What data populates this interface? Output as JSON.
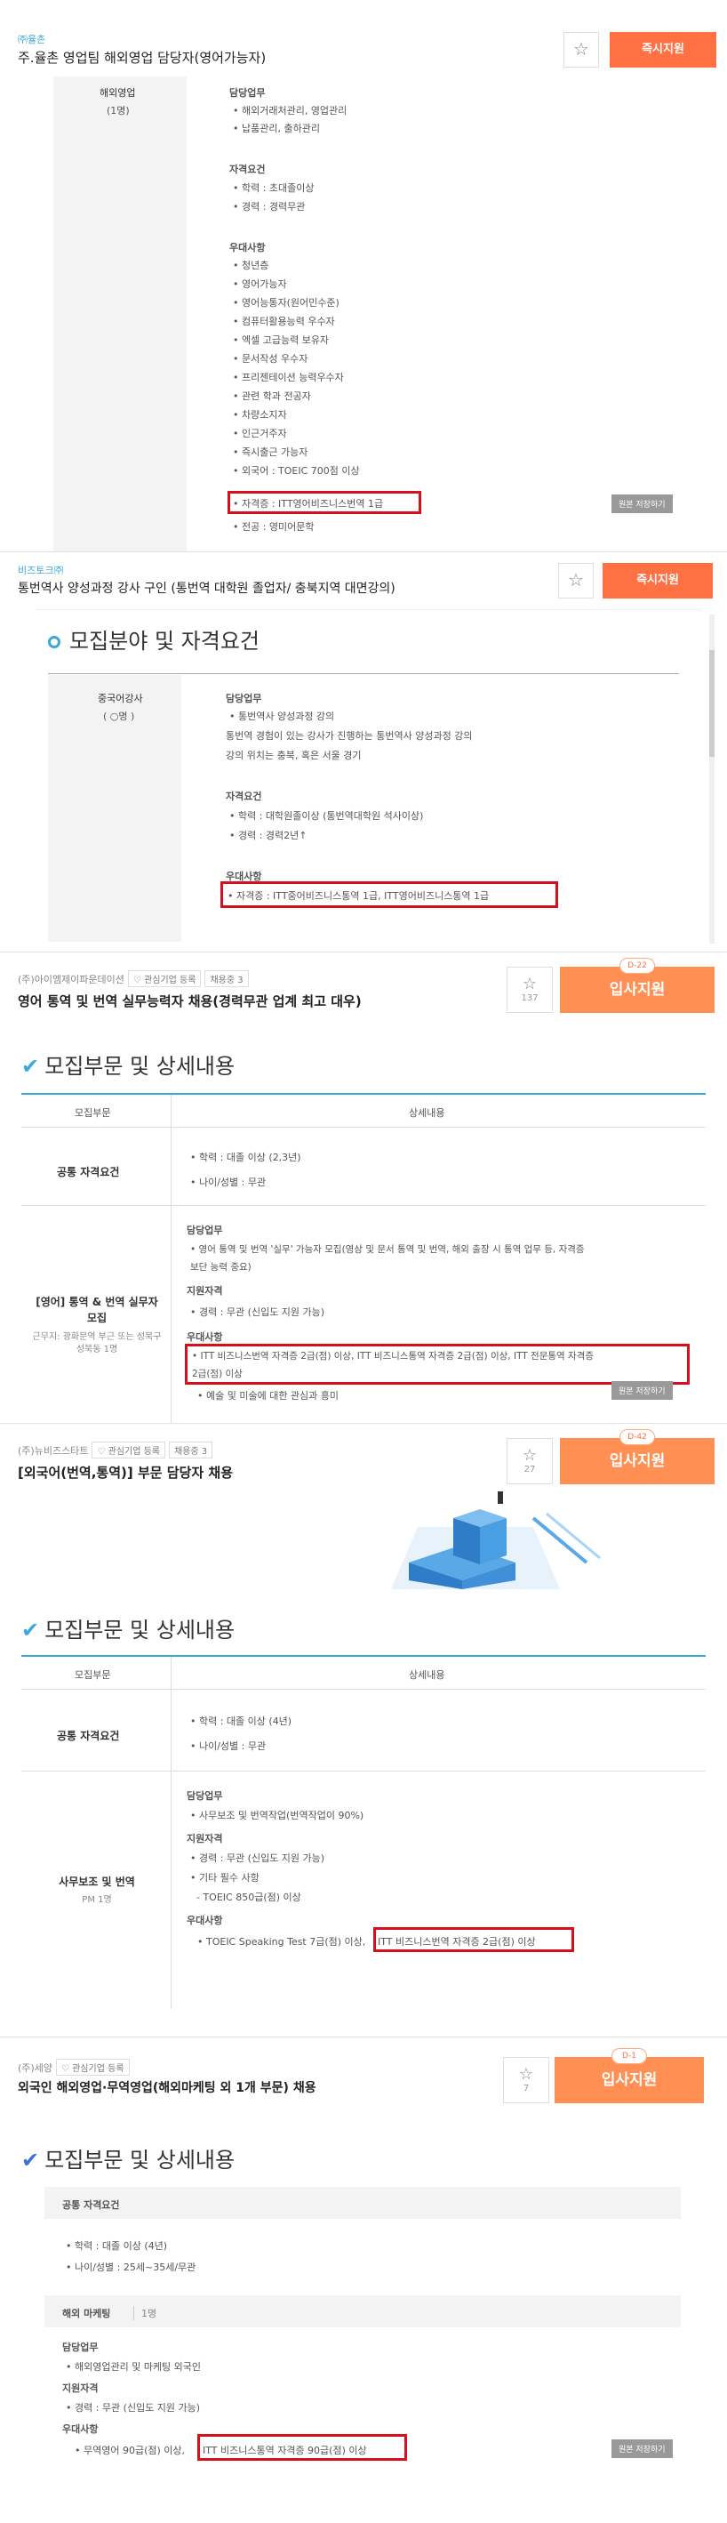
{
  "p1": {
    "company": "㈜율촌",
    "title": "주.율촌 영업팀 해외영업 담당자(영어가능자)",
    "apply": "즉시지원",
    "dept": "해외영업",
    "headcount": "(1명)",
    "duty_h": "담당업무",
    "duties": [
      "• 해외거래처관리, 영업관리",
      "• 납품관리, 출하관리"
    ],
    "qual_h": "자격요건",
    "quals": [
      "• 학력 : 초대졸이상",
      "• 경력 : 경력무관"
    ],
    "pref_h": "우대사항",
    "prefs": [
      "• 청년층",
      "• 영어가능자",
      "• 영어능통자(원어민수준)",
      "• 컴퓨터활용능력 우수자",
      "• 엑셀 고급능력 보유자",
      "• 문서작성 우수자",
      "• 프리젠테이션 능력우수자",
      "• 관련 학과 전공자",
      "• 차량소지자",
      "• 인근거주자",
      "• 즉시출근 가능자",
      "• 외국어 : TOEIC 700점 이상"
    ],
    "pref_highlight": "• 자격증 : ITT영어비즈니스번역 1급",
    "pref_last": "• 전공 : 영미어문학",
    "orig": "원본 저장하기"
  },
  "p2": {
    "company": "비즈토크㈜",
    "title": "통번역사 양성과정 강사 구인 (통번역 대학원 졸업자/ 충북지역 대면강의)",
    "apply": "즉시지원",
    "section": "모집분야 및 자격요건",
    "dept": "중국어강사",
    "headcount": "( ○명 )",
    "duty_h": "담당업무",
    "duties": [
      "• 통번역사 양성과정 강의",
      "통번역 경험이 있는 강사가 진행하는 통번역사 양성과정 강의",
      "강의 위치는 충북, 혹은 서울 경기"
    ],
    "qual_h": "자격요건",
    "quals": [
      "• 학력 : 대학원졸이상 (통번역대학원 석사이상)",
      "• 경력 : 경력2년↑"
    ],
    "pref_h": "우대사항",
    "pref_highlight": "• 자격증 : ITT중어비즈니스통역 1급, ITT영어비즈니스통역 1급"
  },
  "p3": {
    "company": "(주)아이엠제이파운데이션",
    "fav": "관심기업 등록",
    "hiring": "채용중 3",
    "title": "영어 통역 및 번역 실무능력자 채용(경력무관 업계 최고 대우)",
    "dday": "D-22",
    "stars": "137",
    "apply": "입사지원",
    "section": "모집부문 및 상세내용",
    "col1": "모집부문",
    "col2": "상세내용",
    "common": "공통 자격요건",
    "common_items": [
      "• 학력 : 대졸 이상 (2,3년)",
      "• 나이/성별 : 무관"
    ],
    "role": "[영어] 통역 & 번역 실무자 모집",
    "role_sub": "근무지: 광화문역 부근 또는 성북구 성북동 1명",
    "duty_h": "담당업무",
    "duties": [
      "• 영어 통역 및 번역 '실무' 가능자 모집(영상 및 문서 통역 및 번역, 해외 출장 시 통역 업무 등, 자격증",
      "보단 능력 중요)"
    ],
    "qual_h": "지원자격",
    "quals": [
      "• 경력 : 무관 (신입도 지원 가능)"
    ],
    "pref_h": "우대사항",
    "pref_highlight": [
      "• ITT 비즈니스번역 자격증 2급(점) 이상, ITT 비즈니스통역 자격증 2급(점) 이상, ITT 전문통역 자격증",
      "2급(점) 이상"
    ],
    "pref_last": "• 예술 및 미술에 대한 관심과 흥미",
    "orig": "원본 저장하기"
  },
  "p4": {
    "company": "(주)뉴비즈스타트",
    "fav": "관심기업 등록",
    "hiring": "채용중 3",
    "title": "[외국어(번역,통역)] 부문 담당자 채용",
    "dday": "D-42",
    "stars": "27",
    "apply": "입사지원",
    "section": "모집부문 및 상세내용",
    "col1": "모집부문",
    "col2": "상세내용",
    "common": "공통 자격요건",
    "common_items": [
      "• 학력 : 대졸 이상 (4년)",
      "• 나이/성별 : 무관"
    ],
    "role": "사무보조 및 번역",
    "role_sub": "PM 1명",
    "duty_h": "담당업무",
    "duties": [
      "• 사무보조 및 번역작업(번역작업이 90%)"
    ],
    "qual_h": "지원자격",
    "quals": [
      "• 경력 : 무관 (신입도 지원 가능)",
      "• 기타 필수 사항",
      "  - TOEIC 850급(점) 이상"
    ],
    "pref_h": "우대사항",
    "pref_a": "• TOEIC Speaking Test 7급(점) 이상,",
    "pref_highlight": "ITT 비즈니스번역 자격증 2급(점) 이상"
  },
  "p5": {
    "company": "(주)세양",
    "fav": "관심기업 등록",
    "title": "외국인 해외영업·무역영업(해외마케팅 외 1개 부문) 채용",
    "dday": "D-1",
    "stars": "7",
    "apply": "입사지원",
    "section": "모집부문 및 상세내용",
    "common": "공통 자격요건",
    "common_items": [
      "• 학력 : 대졸 이상 (4년)",
      "• 나이/성별 : 25세~35세/무관"
    ],
    "role": "해외 마케팅",
    "role_sub": "1명",
    "duty_h": "담당업무",
    "duties": [
      "• 해외영업관리 및 마케팅 외국인"
    ],
    "qual_h": "지원자격",
    "quals": [
      "• 경력 : 무관 (신입도 지원 가능)"
    ],
    "pref_h": "우대사항",
    "pref_a": "• 무역영어 90급(점) 이상,",
    "pref_highlight": "ITT 비즈니스통역 자격증 90급(점) 이상",
    "orig": "원본 저장하기"
  },
  "colors": {
    "accent": "#3aa7dd",
    "apply": "#ff7043",
    "highlight": "#d60f1d"
  },
  "icons": {
    "star": "star-icon",
    "heart": "heart-icon",
    "check": "check-icon",
    "circle": "circle-bullet-icon"
  }
}
